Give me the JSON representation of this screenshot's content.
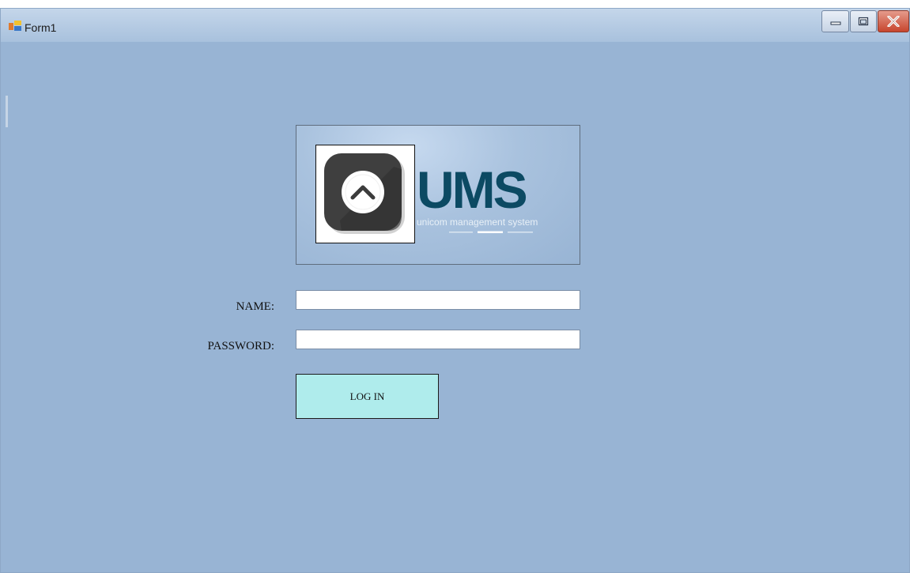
{
  "window": {
    "title": "Form1",
    "app_icon": "windows-form-icon",
    "controls": {
      "minimize_icon": "minimize-icon",
      "maximize_icon": "maximize-icon",
      "close_icon": "close-icon"
    }
  },
  "logo": {
    "text": "UMS",
    "subtitle": "unicom management system",
    "icon": "chevron-up-circle-icon"
  },
  "form": {
    "name_label": "NAME:",
    "name_value": "",
    "password_label": "PASSWORD:",
    "password_value": "",
    "login_label": "LOG IN"
  },
  "colors": {
    "form_background": "#98b4d4",
    "logo_text": "#0c4a63",
    "login_button": "#afecec",
    "close_button": "#c7452d"
  }
}
